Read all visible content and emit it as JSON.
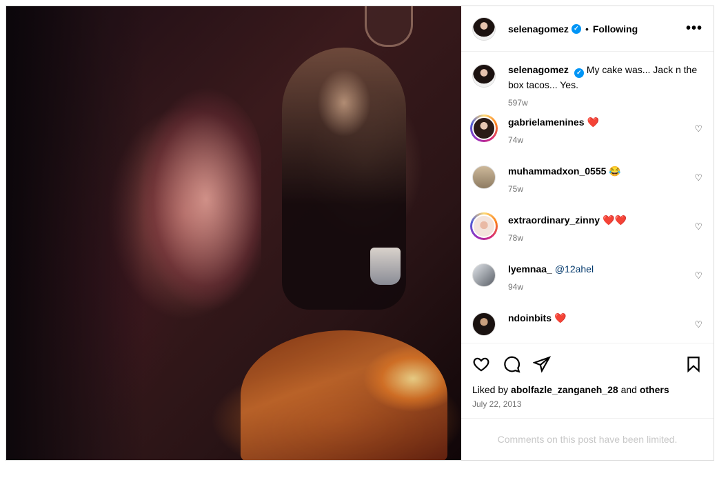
{
  "header": {
    "username": "selenagomez",
    "separator": "•",
    "follow_status": "Following",
    "more_label": "•••"
  },
  "caption": {
    "username": "selenagomez",
    "text": "My cake was... Jack n the box tacos... Yes.",
    "time": "597w"
  },
  "comments": [
    {
      "username": "gabrielamenines",
      "text": "❤️",
      "time": "74w"
    },
    {
      "username": "muhammadxon_0555",
      "text": "😂",
      "time": "75w"
    },
    {
      "username": "extraordinary_zinny",
      "text": "❤️❤️",
      "time": "78w"
    },
    {
      "username": "lyemnaa_",
      "text": "@12ahel",
      "time": "94w"
    },
    {
      "username": "ndoinbits",
      "text": "❤️",
      "time": ""
    }
  ],
  "likes": {
    "prefix": "Liked by",
    "user": "abolfazle_zanganeh_28",
    "conj": "and",
    "others": "others"
  },
  "date": "July 22, 2013",
  "limited_notice": "Comments on this post have been limited.",
  "icons": {
    "like": "heart-icon",
    "comment": "comment-icon",
    "share": "share-icon",
    "save": "bookmark-icon",
    "verified": "verified-icon"
  },
  "colors": {
    "verified": "#0095f6",
    "muted": "#737373",
    "mention": "#00376b"
  }
}
